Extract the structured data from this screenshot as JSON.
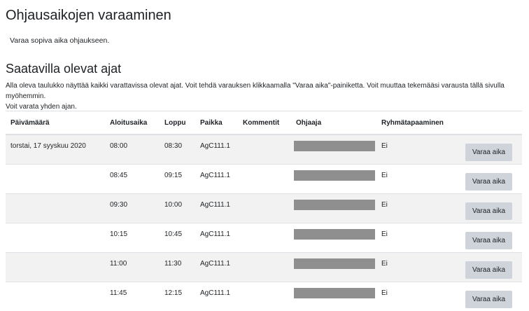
{
  "page": {
    "title": "Ohjausaikojen varaaminen",
    "intro": "Varaa sopiva aika ohjaukseen."
  },
  "section": {
    "title": "Saatavilla olevat ajat",
    "description_1": "Alla oleva taulukko näyttää kaikki varattavissa olevat ajat. Voit tehdä varauksen klikkaamalla \"Varaa aika\"-painiketta. Voit muuttaa tekemääsi varausta tällä sivulla myöhemmin.",
    "description_2": "Voit varata yhden ajan."
  },
  "table": {
    "headers": {
      "date": "Päivämäärä",
      "start": "Aloitusaika",
      "end": "Loppu",
      "location": "Paikka",
      "comments": "Kommentit",
      "tutor": "Ohjaaja",
      "group": "Ryhmätapaaminen",
      "action": ""
    },
    "rows": [
      {
        "date": "torstai, 17 syyskuu 2020",
        "start": "08:00",
        "end": "08:30",
        "location": "AgC111.1",
        "comments": "",
        "group": "Ei",
        "button": "Varaa aika"
      },
      {
        "date": "",
        "start": "08:45",
        "end": "09:15",
        "location": "AgC111.1",
        "comments": "",
        "group": "Ei",
        "button": "Varaa aika"
      },
      {
        "date": "",
        "start": "09:30",
        "end": "10:00",
        "location": "AgC111.1",
        "comments": "",
        "group": "Ei",
        "button": "Varaa aika"
      },
      {
        "date": "",
        "start": "10:15",
        "end": "10:45",
        "location": "AgC111.1",
        "comments": "",
        "group": "Ei",
        "button": "Varaa aika"
      },
      {
        "date": "",
        "start": "11:00",
        "end": "11:30",
        "location": "AgC111.1",
        "comments": "",
        "group": "Ei",
        "button": "Varaa aika"
      },
      {
        "date": "",
        "start": "11:45",
        "end": "12:15",
        "location": "AgC111.1",
        "comments": "",
        "group": "Ei",
        "button": "Varaa aika"
      }
    ]
  },
  "colors": {
    "row_stripe": "#f2f2f2",
    "button_bg": "#ced4da",
    "redacted_bar": "#8f8f8f",
    "border": "#dee2e6"
  }
}
